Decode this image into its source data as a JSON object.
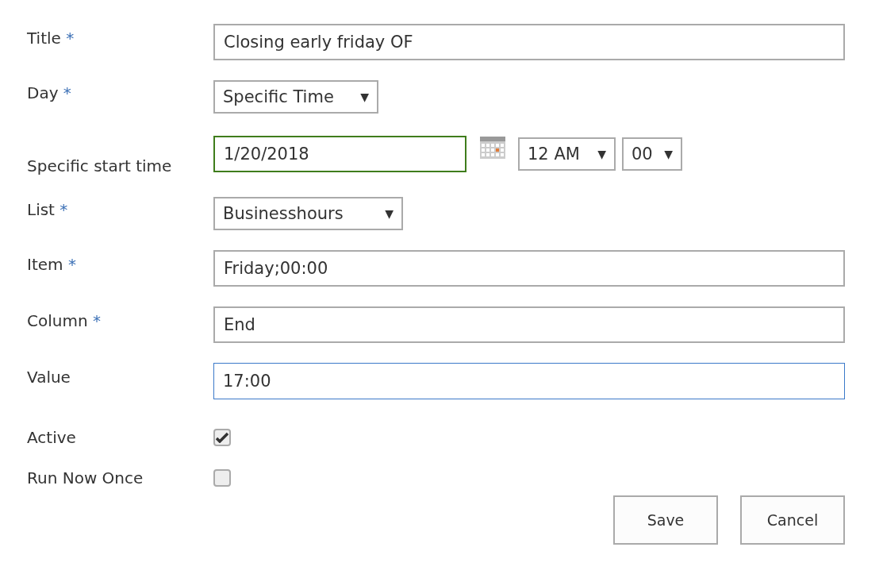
{
  "fields": [
    {
      "kind": "text",
      "label": "Title",
      "required_mark": "*",
      "value": "Closing early friday OF",
      "focused": false
    },
    {
      "kind": "select",
      "label": "Day",
      "required_mark": "*",
      "value": "Specific Time",
      "caret": "▼"
    },
    {
      "kind": "datetime",
      "label": "Specific start time",
      "date": "1/20/2018",
      "valid": true,
      "hour": "12 AM",
      "minute": "00",
      "caret": "▼"
    },
    {
      "kind": "select",
      "label": "List",
      "required_mark": "*",
      "value": "Businesshours",
      "caret": "▼"
    },
    {
      "kind": "text",
      "label": "Item",
      "required_mark": "*",
      "value": "Friday;00:00",
      "focused": false
    },
    {
      "kind": "text",
      "label": "Column",
      "required_mark": "*",
      "value": "End",
      "focused": false
    },
    {
      "kind": "text",
      "label": "Value",
      "value": "17:00",
      "focused": true
    },
    {
      "kind": "checkbox",
      "label": "Active",
      "checked": true
    },
    {
      "kind": "checkbox",
      "label": "Run Now Once",
      "checked": false
    }
  ],
  "buttons": [
    "Save",
    "Cancel"
  ]
}
